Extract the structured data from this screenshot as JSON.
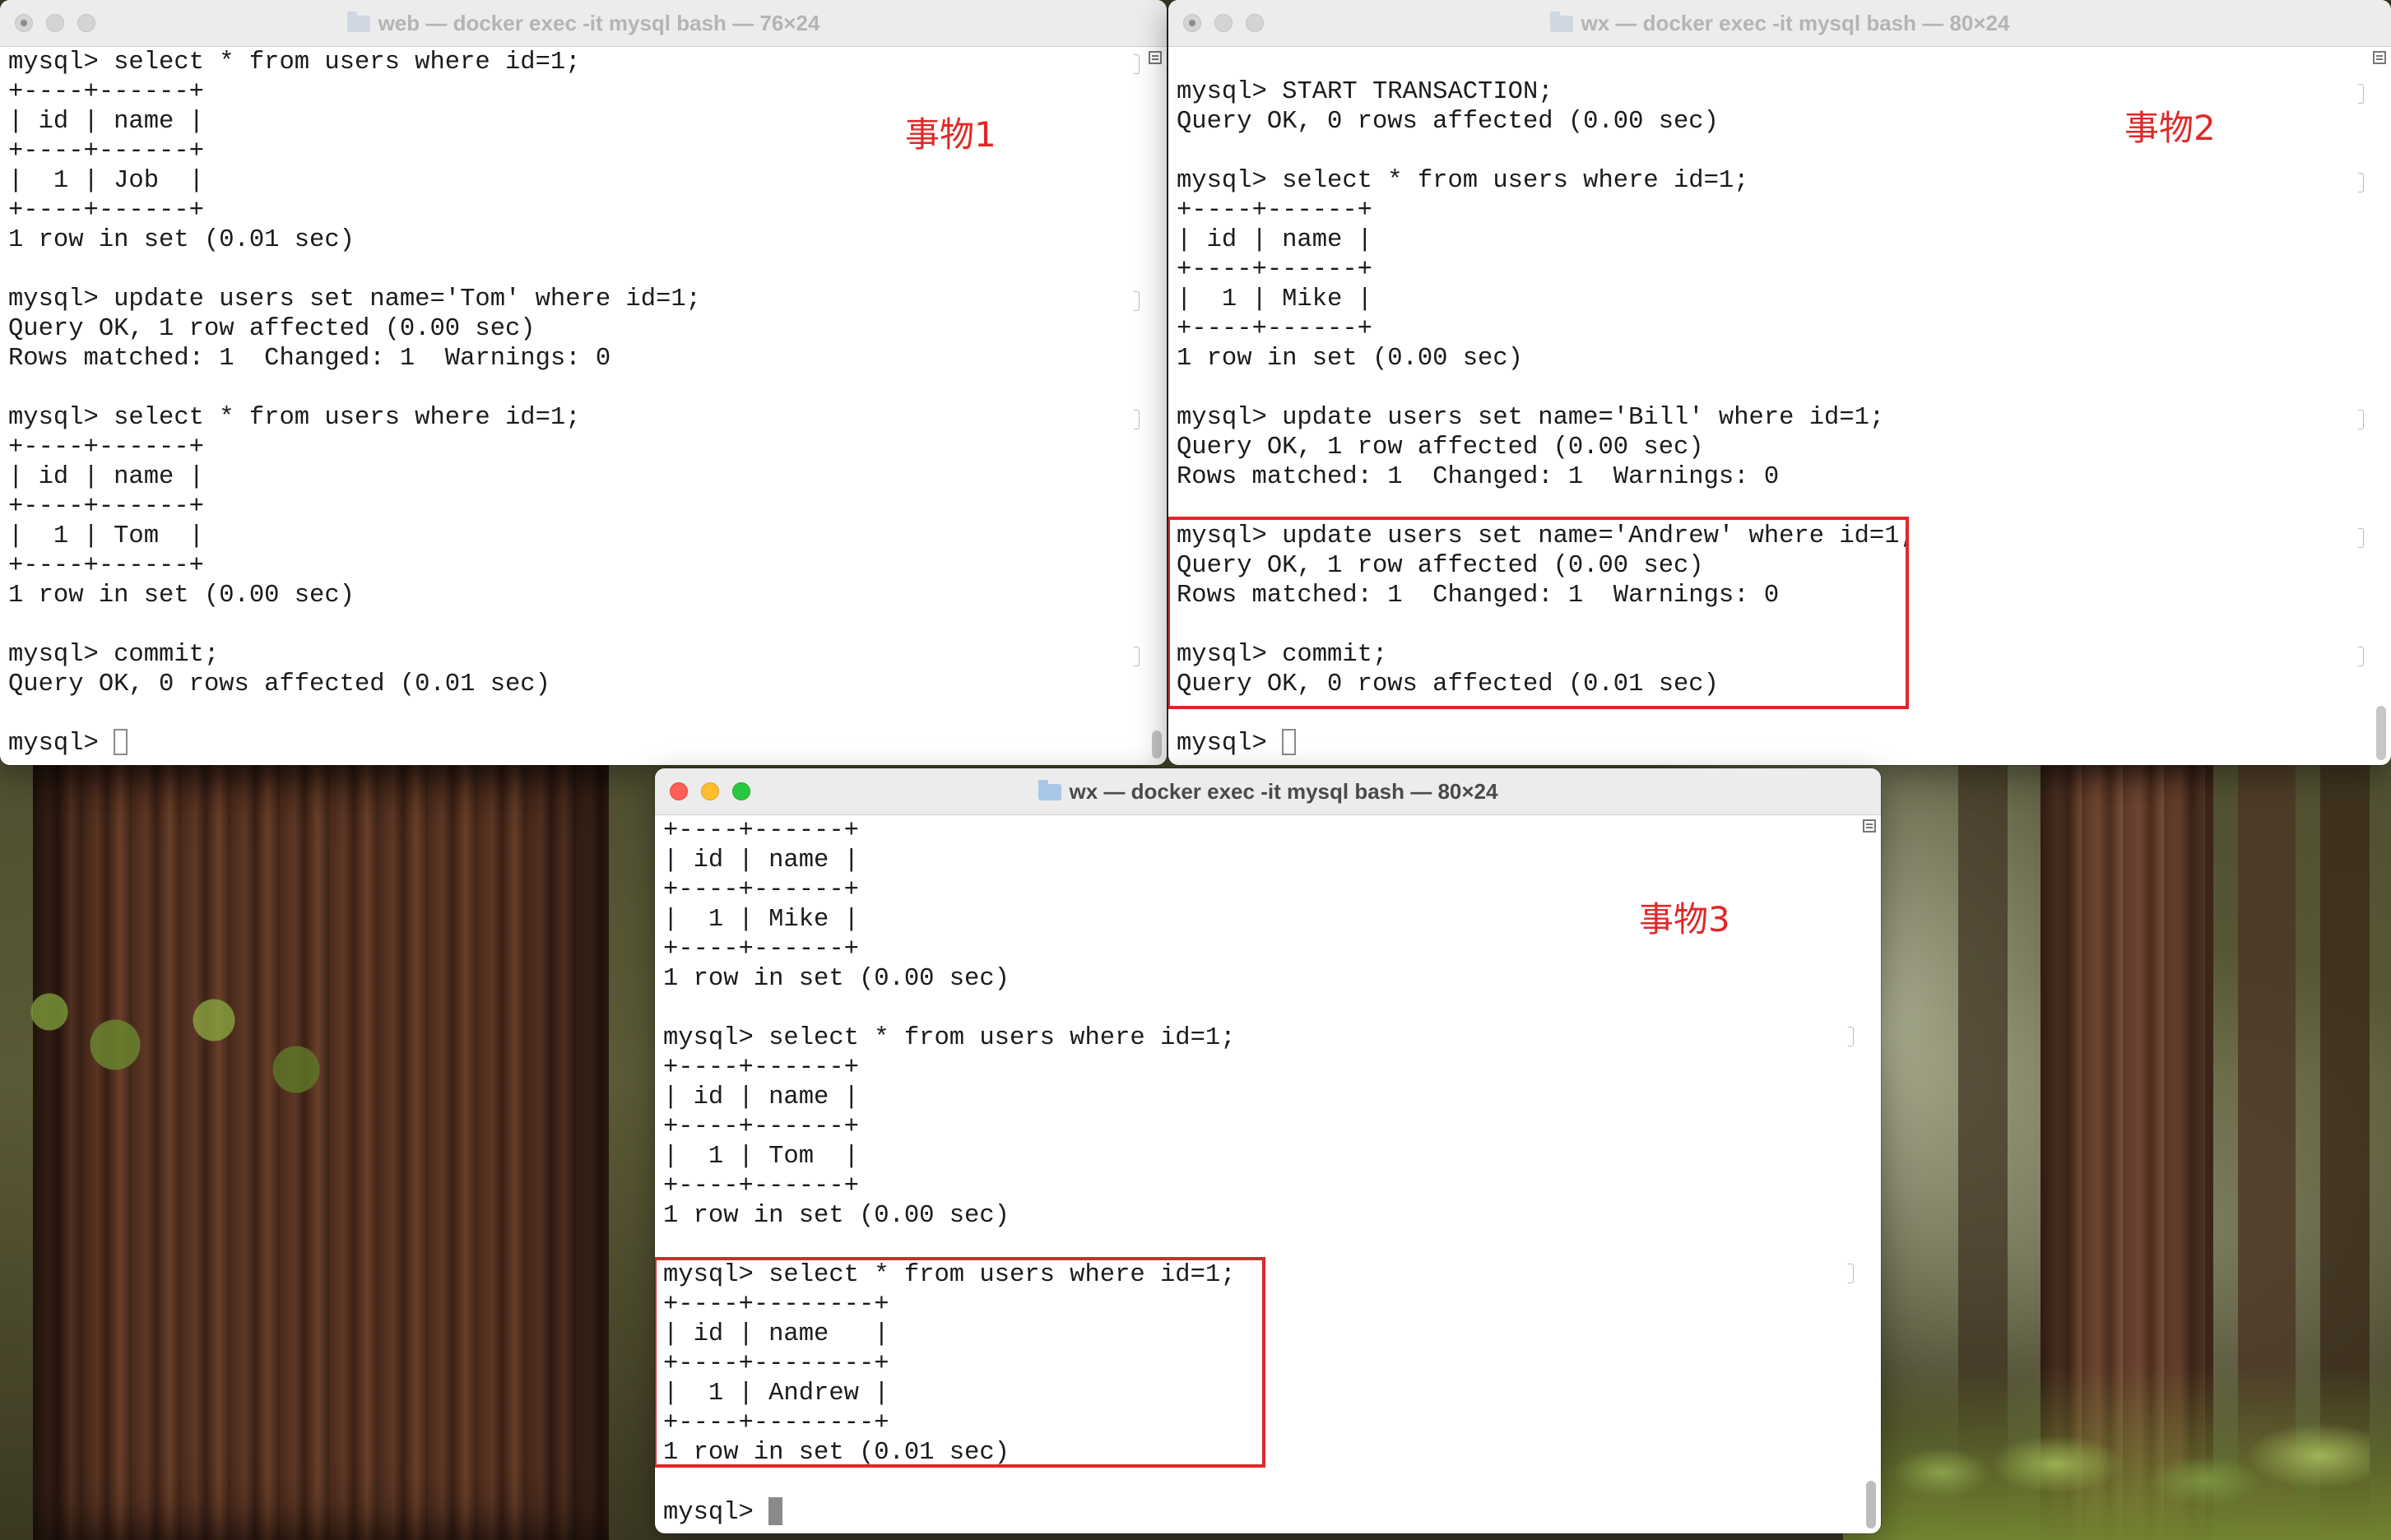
{
  "windows": {
    "win1": {
      "title": "web — docker exec -it mysql bash — 76×24",
      "annotation": "事物1",
      "lines": [
        "mysql> select * from users where id=1;",
        "+----+------+",
        "| id | name |",
        "+----+------+",
        "|  1 | Job  |",
        "+----+------+",
        "1 row in set (0.01 sec)",
        "",
        "mysql> update users set name='Tom' where id=1;",
        "Query OK, 1 row affected (0.00 sec)",
        "Rows matched: 1  Changed: 1  Warnings: 0",
        "",
        "mysql> select * from users where id=1;",
        "+----+------+",
        "| id | name |",
        "+----+------+",
        "|  1 | Tom  |",
        "+----+------+",
        "1 row in set (0.00 sec)",
        "",
        "mysql> commit;",
        "Query OK, 0 rows affected (0.01 sec)",
        ""
      ],
      "prompt": "mysql> "
    },
    "win2": {
      "title": "wx — docker exec -it mysql bash — 80×24",
      "annotation": "事物2",
      "lines": [
        "",
        "mysql> START TRANSACTION;",
        "Query OK, 0 rows affected (0.00 sec)",
        "",
        "mysql> select * from users where id=1;",
        "+----+------+",
        "| id | name |",
        "+----+------+",
        "|  1 | Mike |",
        "+----+------+",
        "1 row in set (0.00 sec)",
        "",
        "mysql> update users set name='Bill' where id=1;",
        "Query OK, 1 row affected (0.00 sec)",
        "Rows matched: 1  Changed: 1  Warnings: 0",
        "",
        "mysql> update users set name='Andrew' where id=1;",
        "Query OK, 1 row affected (0.00 sec)",
        "Rows matched: 1  Changed: 1  Warnings: 0",
        "",
        "mysql> commit;",
        "Query OK, 0 rows affected (0.01 sec)",
        ""
      ],
      "prompt": "mysql> "
    },
    "win3": {
      "title": "wx — docker exec -it mysql bash — 80×24",
      "annotation": "事物3",
      "lines": [
        "+----+------+",
        "| id | name |",
        "+----+------+",
        "|  1 | Mike |",
        "+----+------+",
        "1 row in set (0.00 sec)",
        "",
        "mysql> select * from users where id=1;",
        "+----+------+",
        "| id | name |",
        "+----+------+",
        "|  1 | Tom  |",
        "+----+------+",
        "1 row in set (0.00 sec)",
        "",
        "mysql> select * from users where id=1;",
        "+----+--------+",
        "| id | name   |",
        "+----+--------+",
        "|  1 | Andrew |",
        "+----+--------+",
        "1 row in set (0.01 sec)",
        ""
      ],
      "prompt": "mysql> "
    }
  },
  "colors": {
    "annotation_red": "#e02828",
    "terminal_bg": "#ffffff",
    "terminal_text": "#1b1b1b"
  },
  "icons": [
    "folder-icon",
    "close-light-icon",
    "minimize-light-icon",
    "zoom-light-icon",
    "scrollbar-menu-icon",
    "cursor-block-icon"
  ]
}
